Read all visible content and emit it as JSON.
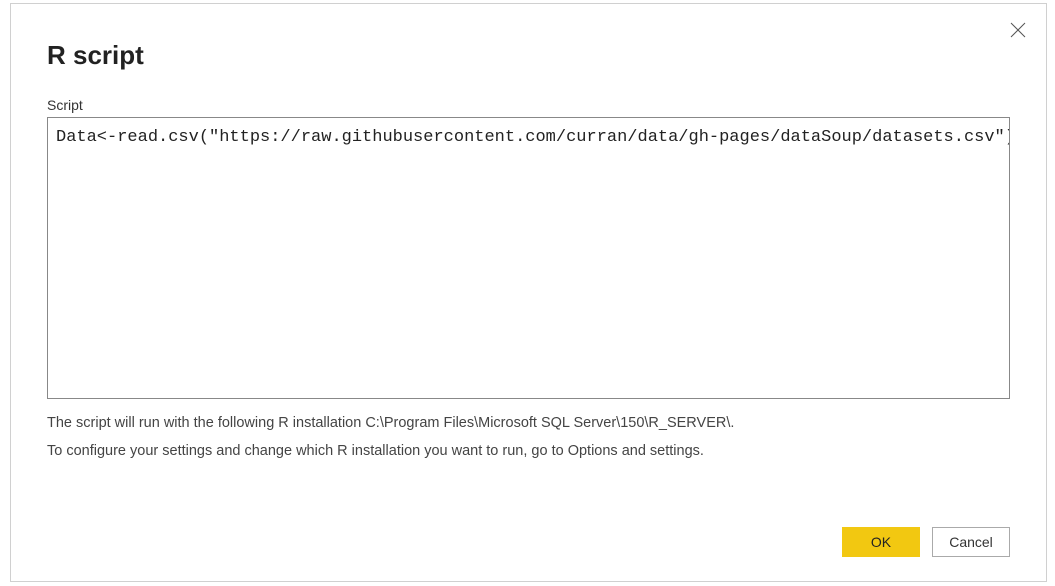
{
  "dialog": {
    "title": "R script",
    "fieldLabel": "Script",
    "scriptValue": "Data<-read.csv(\"https://raw.githubusercontent.com/curran/data/gh-pages/dataSoup/datasets.csv\")",
    "infoLine1": "The script will run with the following R installation C:\\Program Files\\Microsoft SQL Server\\150\\R_SERVER\\.",
    "infoLine2": "To configure your settings and change which R installation you want to run, go to Options and settings.",
    "okLabel": "OK",
    "cancelLabel": "Cancel"
  }
}
